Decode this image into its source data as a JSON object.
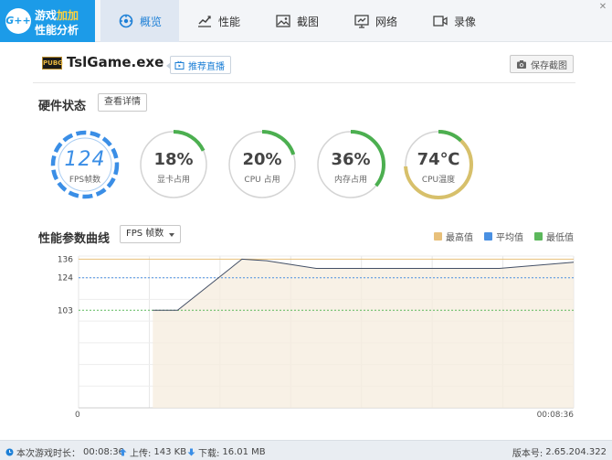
{
  "app": {
    "logo_badge": "G++",
    "logo_line1_a": "游戏",
    "logo_line1_b": "加加",
    "logo_line2": "性能分析"
  },
  "nav": {
    "tabs": [
      {
        "label": "概览",
        "icon": "overview-icon",
        "active": true
      },
      {
        "label": "性能",
        "icon": "performance-chart-icon",
        "active": false
      },
      {
        "label": "截图",
        "icon": "screenshot-image-icon",
        "active": false
      },
      {
        "label": "网络",
        "icon": "network-icon",
        "active": false
      },
      {
        "label": "录像",
        "icon": "video-record-icon",
        "active": false
      }
    ],
    "close_glyph": "✕"
  },
  "game": {
    "logo_text": "PUBG",
    "name": "TslGame.exe",
    "recommend_label": "推荐直播",
    "save_screenshot_label": "保存截图"
  },
  "hardware": {
    "title": "硬件状态",
    "detail_button": "查看详情",
    "gauges": [
      {
        "id": "fps",
        "value": "124",
        "label": "FPS帧数",
        "fraction": 1.0,
        "color": "#3a8ee6"
      },
      {
        "id": "gpu",
        "value": "18%",
        "label": "显卡占用",
        "fraction": 0.18,
        "color": "#4caf50"
      },
      {
        "id": "cpu",
        "value": "20%",
        "label": "CPU 占用",
        "fraction": 0.2,
        "color": "#4caf50"
      },
      {
        "id": "mem",
        "value": "36%",
        "label": "内存占用",
        "fraction": 0.36,
        "color": "#4caf50"
      },
      {
        "id": "temp",
        "value": "74℃",
        "label": "CPU温度",
        "fraction": 0.74,
        "color": "#d7c06b"
      }
    ]
  },
  "curve": {
    "title": "性能参数曲线",
    "select_value": "FPS  帧数",
    "legend": [
      {
        "label": "最高值",
        "color": "#e8c07a"
      },
      {
        "label": "平均值",
        "color": "#4a90e2"
      },
      {
        "label": "最低值",
        "color": "#5cb85c"
      }
    ]
  },
  "chart_data": {
    "type": "line",
    "y_ticks": [
      103,
      124,
      136
    ],
    "ylim": [
      40,
      138
    ],
    "max": 136,
    "avg": 124,
    "min": 103,
    "x_start_label": "0",
    "x_end_label": "00:08:36",
    "x": [
      0.15,
      0.2,
      0.33,
      0.38,
      0.48,
      0.6,
      0.75,
      0.85,
      1.0
    ],
    "y": [
      103,
      103,
      136,
      135,
      130,
      130,
      130,
      130,
      134
    ]
  },
  "status": {
    "session_label": "本次游戏时长：",
    "session_value": "00:08:36",
    "upload_label": "上传:",
    "upload_value": "143 KB",
    "download_label": "下载:",
    "download_value": "16.01 MB",
    "version_label": "版本号:",
    "version_value": "2.65.204.322"
  }
}
